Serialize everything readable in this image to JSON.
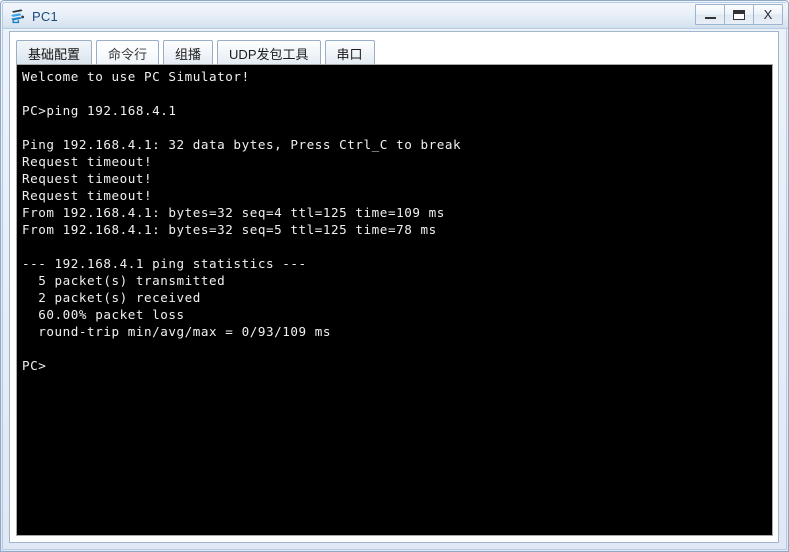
{
  "window": {
    "title": "PC1",
    "icon": "pc-device-icon",
    "controls": {
      "minimize_label": "–",
      "maximize_label": "☐",
      "close_label": "X",
      "minimize_name": "minimize-button",
      "maximize_name": "maximize-button",
      "close_name": "close-button"
    }
  },
  "tabs": [
    {
      "label": "基础配置",
      "state": "inactive"
    },
    {
      "label": "命令行",
      "state": "active"
    },
    {
      "label": "组播",
      "state": "inactive"
    },
    {
      "label": "UDP发包工具",
      "state": "inactive"
    },
    {
      "label": "串口",
      "state": "inactive"
    }
  ],
  "terminal": {
    "prompt": "PC>",
    "command": "ping 192.168.4.1",
    "content": "Welcome to use PC Simulator!\n\nPC>ping 192.168.4.1\n\nPing 192.168.4.1: 32 data bytes, Press Ctrl_C to break\nRequest timeout!\nRequest timeout!\nRequest timeout!\nFrom 192.168.4.1: bytes=32 seq=4 ttl=125 time=109 ms\nFrom 192.168.4.1: bytes=32 seq=5 ttl=125 time=78 ms\n\n--- 192.168.4.1 ping statistics ---\n  5 packet(s) transmitted\n  2 packet(s) received\n  60.00% packet loss\n  round-trip min/avg/max = 0/93/109 ms\n\nPC>",
    "lines": [
      "Welcome to use PC Simulator!",
      "",
      "PC>ping 192.168.4.1",
      "",
      "Ping 192.168.4.1: 32 data bytes, Press Ctrl_C to break",
      "Request timeout!",
      "Request timeout!",
      "Request timeout!",
      "From 192.168.4.1: bytes=32 seq=4 ttl=125 time=109 ms",
      "From 192.168.4.1: bytes=32 seq=5 ttl=125 time=78 ms",
      "",
      "--- 192.168.4.1 ping statistics ---",
      "  5 packet(s) transmitted",
      "  2 packet(s) received",
      "  60.00% packet loss",
      "  round-trip min/avg/max = 0/93/109 ms",
      "",
      "PC>"
    ],
    "ping_summary": {
      "target": "192.168.4.1",
      "data_bytes": 32,
      "packets_transmitted": 5,
      "packets_received": 2,
      "packet_loss_percent": "60.00%",
      "rtt_min_ms": 0,
      "rtt_avg_ms": 93,
      "rtt_max_ms": 109,
      "replies": [
        {
          "seq": 4,
          "bytes": 32,
          "ttl": 125,
          "time_ms": 109
        },
        {
          "seq": 5,
          "bytes": 32,
          "ttl": 125,
          "time_ms": 78
        }
      ],
      "timeouts": 3
    }
  },
  "colors": {
    "title_text": "#1a4b80",
    "terminal_bg": "#000000",
    "terminal_fg": "#f0f0f0",
    "window_border": "#8fa9c4"
  }
}
